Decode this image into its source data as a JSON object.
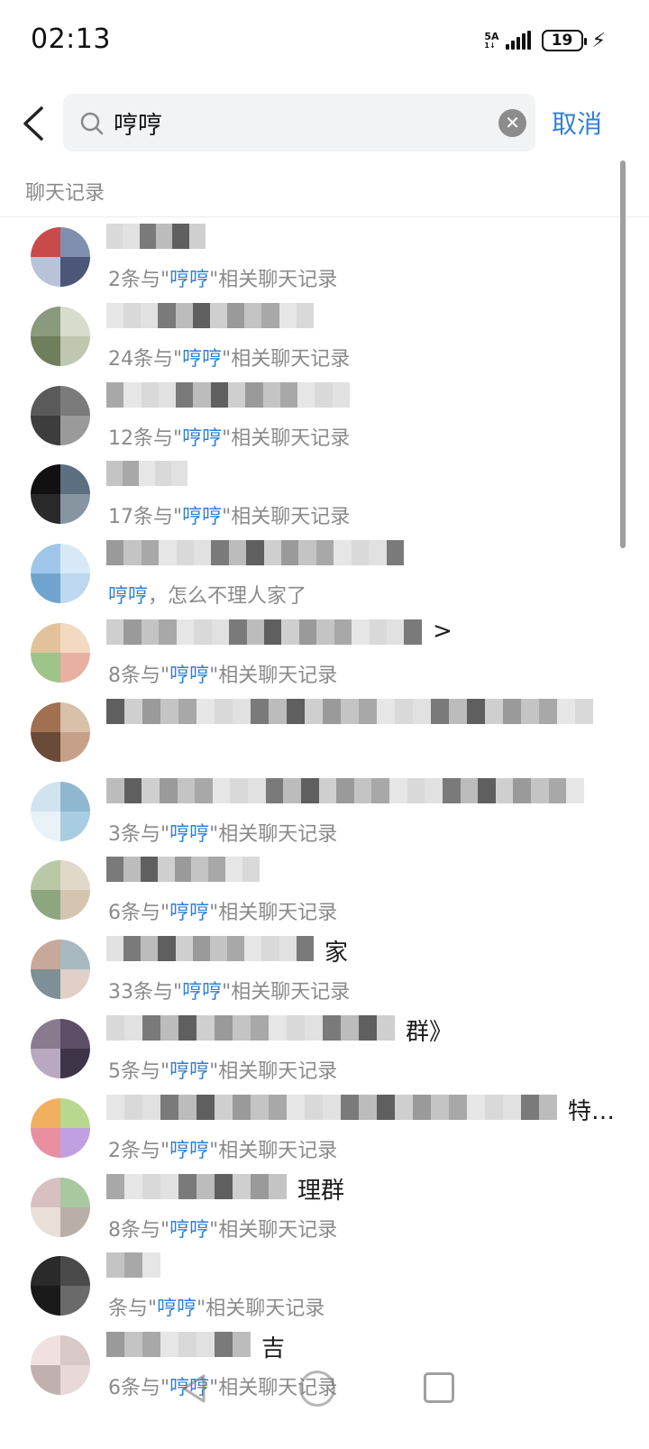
{
  "status_bar": {
    "time": "02:13",
    "network_top": "5A",
    "network_bottom": "1↓",
    "battery": "19",
    "charging_icon": "⚡"
  },
  "search": {
    "query": "哼哼",
    "cancel_label": "取消",
    "clear_icon": "clear-icon",
    "search_icon": "search-icon"
  },
  "section": {
    "title": "聊天记录"
  },
  "colors": {
    "accent": "#2f7fd6",
    "secondary_text": "#8a8a8a",
    "search_bg": "#f2f3f5"
  },
  "results": [
    {
      "name_suffix": "",
      "prefix": "2条与\"",
      "keyword": "哼哼",
      "suffix": "\"相关聊天记录"
    },
    {
      "name_suffix": "",
      "prefix": "24条与\"",
      "keyword": "哼哼",
      "suffix": "\"相关聊天记录"
    },
    {
      "name_suffix": "",
      "prefix": "12条与\"",
      "keyword": "哼哼",
      "suffix": "\"相关聊天记录"
    },
    {
      "name_suffix": "",
      "prefix": "17条与\"",
      "keyword": "哼哼",
      "suffix": "\"相关聊天记录"
    },
    {
      "name_suffix": "",
      "prefix": "",
      "keyword": "哼哼",
      "suffix": "，怎么不理人家了"
    },
    {
      "name_suffix": ">",
      "prefix": "8条与\"",
      "keyword": "哼哼",
      "suffix": "\"相关聊天记录"
    },
    {
      "name_suffix": "",
      "prefix": "",
      "keyword": "",
      "suffix": ""
    },
    {
      "name_suffix": "",
      "prefix": "3条与\"",
      "keyword": "哼哼",
      "suffix": "\"相关聊天记录"
    },
    {
      "name_suffix": "",
      "prefix": "6条与\"",
      "keyword": "哼哼",
      "suffix": "\"相关聊天记录"
    },
    {
      "name_suffix": "家",
      "prefix": "33条与\"",
      "keyword": "哼哼",
      "suffix": "\"相关聊天记录"
    },
    {
      "name_suffix": "群》",
      "prefix": "5条与\"",
      "keyword": "哼哼",
      "suffix": "\"相关聊天记录"
    },
    {
      "name_suffix": "特…",
      "prefix": "2条与\"",
      "keyword": "哼哼",
      "suffix": "\"相关聊天记录"
    },
    {
      "name_suffix": "理群",
      "prefix": "8条与\"",
      "keyword": "哼哼",
      "suffix": "\"相关聊天记录"
    },
    {
      "name_suffix": "",
      "prefix": "条与\"",
      "keyword": "哼哼",
      "suffix": "\"相关聊天记录"
    },
    {
      "name_suffix": "吉",
      "prefix": "6条与\"",
      "keyword": "哼哼",
      "suffix": "\"相关聊天记录"
    }
  ]
}
